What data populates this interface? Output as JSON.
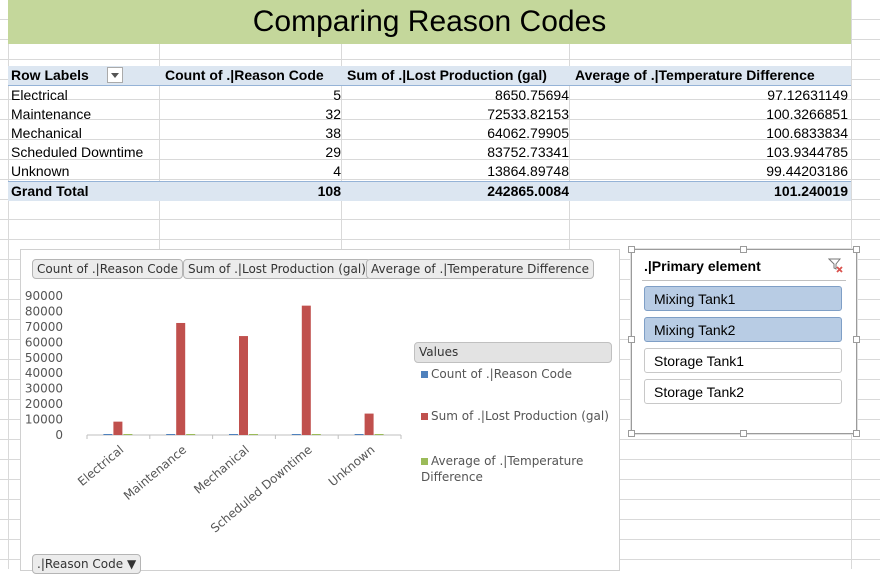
{
  "title": "Comparing Reason Codes",
  "pivot": {
    "headers": {
      "row_labels": "Row Labels",
      "count": "Count of .|Reason Code",
      "sum": "Sum of .|Lost Production (gal)",
      "avg": "Average of .|Temperature Difference"
    },
    "rows": [
      {
        "label": "Electrical",
        "count": "5",
        "sum": "8650.75694",
        "avg": "97.12631149"
      },
      {
        "label": "Maintenance",
        "count": "32",
        "sum": "72533.82153",
        "avg": "100.3266851"
      },
      {
        "label": "Mechanical",
        "count": "38",
        "sum": "64062.79905",
        "avg": "100.6833834"
      },
      {
        "label": "Scheduled Downtime",
        "count": "29",
        "sum": "83752.73341",
        "avg": "103.9344785"
      },
      {
        "label": "Unknown",
        "count": "4",
        "sum": "13864.89748",
        "avg": "99.44203186"
      }
    ],
    "total": {
      "label": "Grand Total",
      "count": "108",
      "sum": "242865.0084",
      "avg": "101.240019"
    }
  },
  "chart": {
    "field_buttons": [
      "Count of .|Reason Code",
      "Sum of .|Lost Production (gal)",
      "Average of .|Temperature Difference"
    ],
    "legend_title": "Values",
    "legend": [
      {
        "name": "Count of .|Reason Code",
        "color": "#4f81bd"
      },
      {
        "name": "Sum of .|Lost Production (gal)",
        "color": "#c0504d"
      },
      {
        "name": "Average of .|Temperature Difference",
        "color": "#9bbb59"
      }
    ],
    "axis_field_button": ".|Reason Code"
  },
  "chart_data": {
    "type": "bar",
    "categories": [
      "Electrical",
      "Maintenance",
      "Mechanical",
      "Scheduled Downtime",
      "Unknown"
    ],
    "series": [
      {
        "name": "Count of .|Reason Code",
        "values": [
          5,
          32,
          38,
          29,
          4
        ]
      },
      {
        "name": "Sum of .|Lost Production (gal)",
        "values": [
          8650.75694,
          72533.82153,
          64062.79905,
          83752.73341,
          13864.89748
        ]
      },
      {
        "name": "Average of .|Temperature Difference",
        "values": [
          97.12631149,
          100.3266851,
          100.6833834,
          103.9344785,
          99.44203186
        ]
      }
    ],
    "ylim": [
      0,
      90000
    ],
    "yticks": [
      0,
      10000,
      20000,
      30000,
      40000,
      50000,
      60000,
      70000,
      80000,
      90000
    ],
    "legend_position": "right",
    "grid": false
  },
  "slicer": {
    "title": ".|Primary element",
    "items": [
      {
        "label": "Mixing Tank1",
        "selected": true
      },
      {
        "label": "Mixing Tank2",
        "selected": true
      },
      {
        "label": "Storage Tank1",
        "selected": false
      },
      {
        "label": "Storage Tank2",
        "selected": false
      }
    ]
  }
}
